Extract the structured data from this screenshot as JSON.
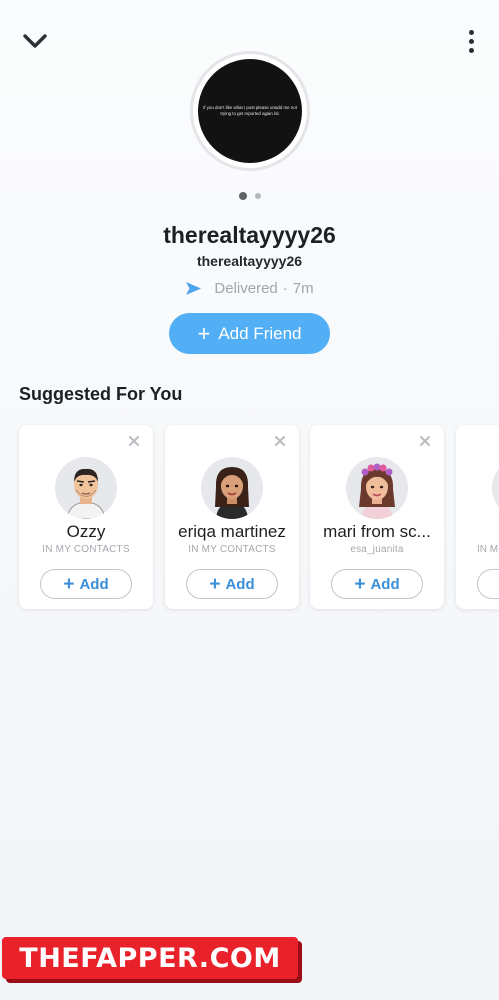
{
  "header": {
    "back_icon": "chevron-down-icon",
    "more_icon": "more-vertical-icon"
  },
  "story": {
    "text": "If you don't like what I post please unadd me not trying to get reported again lol."
  },
  "profile": {
    "display_name": "therealtayyyy26",
    "username": "therealtayyyy26",
    "status": "Delivered",
    "status_time": "7m",
    "status_separator": "·",
    "status_icon": "delivered-arrow-icon",
    "status_color": "#4fa6ee"
  },
  "add_friend": {
    "plus": "+",
    "label": "Add Friend",
    "color": "#52aef5"
  },
  "suggested": {
    "title": "Suggested For You",
    "add_plus": "+",
    "add_label": "Add",
    "cards": [
      {
        "name": "Ozzy",
        "subtitle": "IN MY CONTACTS"
      },
      {
        "name": "eriqa martinez",
        "subtitle": "IN MY CONTACTS"
      },
      {
        "name": "mari from sc...",
        "subtitle": "esa_juanita"
      },
      {
        "name": "",
        "subtitle": "IN M"
      }
    ]
  },
  "watermark": {
    "text": "THEFAPPER.COM"
  }
}
